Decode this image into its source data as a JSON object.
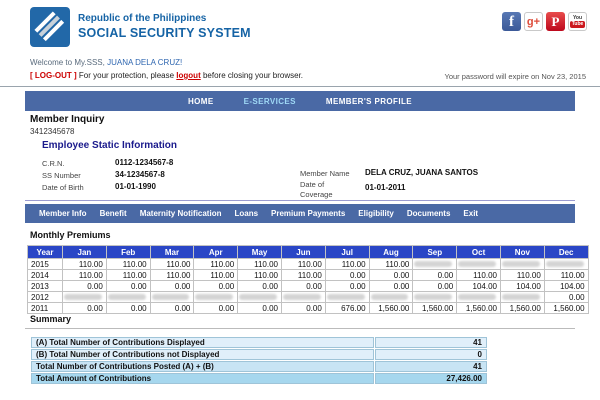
{
  "colors": {
    "brand_blue": "#1563a5",
    "nav_bg": "#4a69a5",
    "table_header_bg": "#2a46c6",
    "active_nav_item": "#9fd9f6",
    "alert_red": "#cc0000",
    "summary_row_light": "#e0effa",
    "summary_row_mid": "#c8e4f4",
    "summary_row_total": "#a6d7ee"
  },
  "header": {
    "org_line1": "Republic of the Philippines",
    "org_line2": "SOCIAL SECURITY SYSTEM",
    "social_icons": [
      "facebook-icon",
      "google-plus-icon",
      "pinterest-icon",
      "youtube-icon"
    ],
    "welcome_prefix": "Welcome to My.SSS,",
    "welcome_name": "JUANA DELA CRUZ!",
    "logout_bracket": "[ LOG-OUT ]",
    "logout_text_before": "For your protection, please",
    "logout_link": "logout",
    "logout_text_after": "before closing your browser.",
    "password_note": "Your password will expire on Nov 23, 2015"
  },
  "main_nav": {
    "items": [
      {
        "label": "HOME",
        "active": false
      },
      {
        "label": "E-SERVICES",
        "active": true
      },
      {
        "label": "MEMBER'S PROFILE",
        "active": false
      }
    ]
  },
  "member": {
    "section_title": "Member Inquiry",
    "member_number": "3412345678",
    "subsection_title": "Employee Static Information",
    "crn_label": "C.R.N.",
    "crn_value": "0112-1234567-8",
    "ss_label": "SS Number",
    "ss_value": "34-1234567-8",
    "dob_label": "Date of Birth",
    "dob_value": "01-01-1990",
    "name_label": "Member Name",
    "name_value": "DELA CRUZ, JUANA SANTOS",
    "coverage_label": "Date of Coverage",
    "coverage_value": "01-01-2011"
  },
  "sub_nav": {
    "items": [
      "Member Info",
      "Benefit",
      "Maternity Notification",
      "Loans",
      "Premium Payments",
      "Eligibility",
      "Documents",
      "Exit"
    ]
  },
  "premiums": {
    "heading": "Monthly Premiums",
    "columns": [
      "Year",
      "Jan",
      "Feb",
      "Mar",
      "Apr",
      "May",
      "Jun",
      "Jul",
      "Aug",
      "Sep",
      "Oct",
      "Nov",
      "Dec"
    ],
    "rows": [
      {
        "year": "2015",
        "values": [
          "110.00",
          "110.00",
          "110.00",
          "110.00",
          "110.00",
          "110.00",
          "110.00",
          "110.00",
          null,
          null,
          null,
          null
        ]
      },
      {
        "year": "2014",
        "values": [
          "110.00",
          "110.00",
          "110.00",
          "110.00",
          "110.00",
          "110.00",
          "0.00",
          "0.00",
          "0.00",
          "110.00",
          "110.00",
          "110.00"
        ]
      },
      {
        "year": "2013",
        "values": [
          "0.00",
          "0.00",
          "0.00",
          "0.00",
          "0.00",
          "0.00",
          "0.00",
          "0.00",
          "0.00",
          "104.00",
          "104.00",
          "104.00"
        ]
      },
      {
        "year": "2012",
        "values": [
          null,
          null,
          null,
          null,
          null,
          null,
          null,
          null,
          null,
          null,
          null,
          "0.00"
        ]
      },
      {
        "year": "2011",
        "values": [
          "0.00",
          "0.00",
          "0.00",
          "0.00",
          "0.00",
          "0.00",
          "676.00",
          "1,560.00",
          "1,560.00",
          "1,560.00",
          "1,560.00",
          "1,560.00"
        ]
      }
    ]
  },
  "summary": {
    "heading": "Summary",
    "rows": [
      {
        "label": "(A) Total Number of Contributions Displayed",
        "value": "41",
        "tone": "light"
      },
      {
        "label": "(B) Total Number of Contributions not Displayed",
        "value": "0",
        "tone": "light"
      },
      {
        "label": "Total Number of Contributions Posted (A) + (B)",
        "value": "41",
        "tone": "mid"
      },
      {
        "label": "Total Amount of Contributions",
        "value": "27,426.00",
        "tone": "total"
      }
    ]
  }
}
